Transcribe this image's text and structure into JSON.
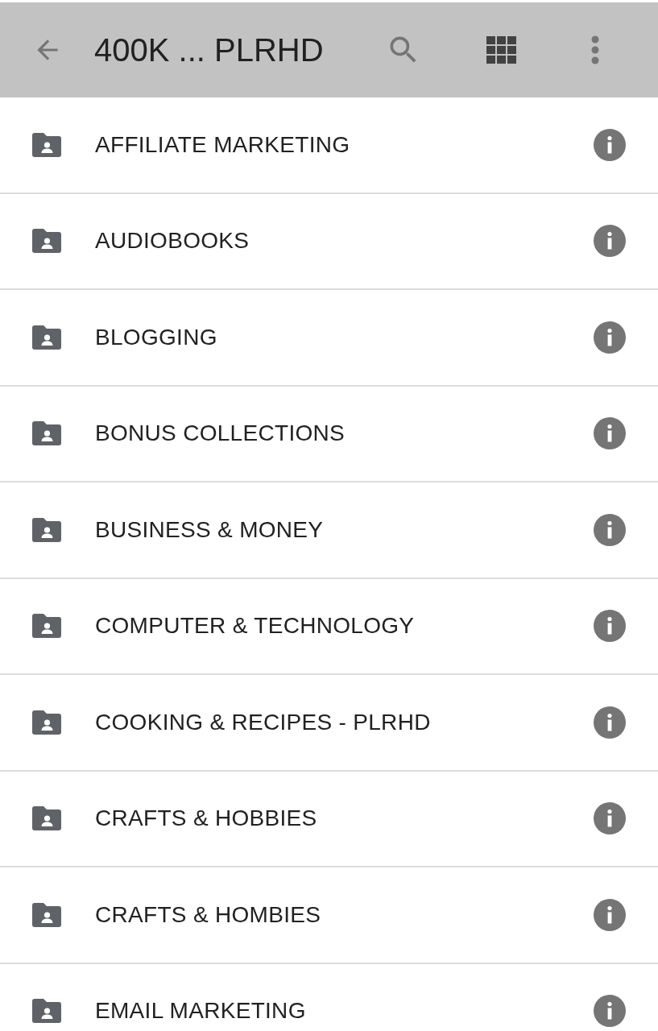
{
  "toolbar": {
    "title": "400K ... PLRHD"
  },
  "folders": [
    {
      "name": "AFFILIATE MARKETING"
    },
    {
      "name": "AUDIOBOOKS"
    },
    {
      "name": "BLOGGING"
    },
    {
      "name": "BONUS COLLECTIONS"
    },
    {
      "name": "BUSINESS & MONEY"
    },
    {
      "name": "COMPUTER & TECHNOLOGY"
    },
    {
      "name": "COOKING & RECIPES - PLRHD"
    },
    {
      "name": "CRAFTS & HOBBIES"
    },
    {
      "name": "CRAFTS & HOMBIES"
    },
    {
      "name": "EMAIL MARKETING"
    }
  ]
}
